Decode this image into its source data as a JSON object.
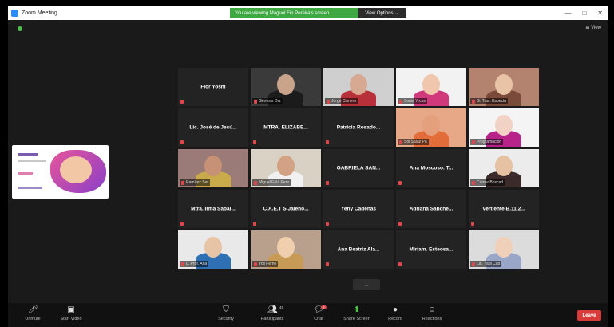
{
  "titlebar": {
    "app_title": "Zoom Meeting",
    "banner_message": "You are viewing Maguel Fin Pereira's screen",
    "banner_button": "View Options ⌄",
    "minimize": "—",
    "maximize": "□",
    "close": "✕"
  },
  "meeting": {
    "view_button": "⊞ View",
    "page_down": "⌄"
  },
  "tiles": [
    {
      "type": "name",
      "name": "Flor Yoshi"
    },
    {
      "type": "video",
      "label": "Genesis Orz",
      "skin": "#c9a38a",
      "shirt": "#1b1b1b",
      "bg": "#3a3a3a"
    },
    {
      "type": "video",
      "label": "Jorge Cisnero",
      "skin": "#d7a892",
      "shirt": "#b8313a",
      "bg": "#cfcfcf"
    },
    {
      "type": "video",
      "label": "Sonia Yrcos",
      "skin": "#f0c7ad",
      "shirt": "#d03a7d",
      "bg": "#f2f2f2"
    },
    {
      "type": "video",
      "label": "G. Tras. Especia",
      "skin": "#e9c3a6",
      "shirt": "#7a4a3a",
      "bg": "#b48370"
    },
    {
      "type": "name",
      "name": "Lic. José de Jesú..."
    },
    {
      "type": "name",
      "name": "MTRA. ELIZABE..."
    },
    {
      "type": "name",
      "name": "Patricia Rosado..."
    },
    {
      "type": "video",
      "label": "Sol Salaz Pa",
      "skin": "#e4a07c",
      "shirt": "#e36d3a",
      "bg": "#e6a887"
    },
    {
      "type": "video",
      "label": "Programación",
      "skin": "#f3d2c6",
      "shirt": "#b8238a",
      "bg": "#f4f4f4"
    },
    {
      "type": "video",
      "label": "Ramírez Ser",
      "skin": "#c79176",
      "shirt": "#c8aa4b",
      "bg": "#9a7b78"
    },
    {
      "type": "video",
      "label": "Miguel Eulá Pere",
      "skin": "#d3a184",
      "shirt": "#f0f0f0",
      "bg": "#d9d2c4",
      "active": true
    },
    {
      "type": "name",
      "name": "GABRIELA SAN..."
    },
    {
      "type": "name",
      "name": "Ana Moscoso. T..."
    },
    {
      "type": "video",
      "label": "Carme Boscad",
      "skin": "#e6c1a2",
      "shirt": "#3a2a2a",
      "bg": "#ececec"
    },
    {
      "type": "name",
      "name": "Mtra. Irma Sabal..."
    },
    {
      "type": "name",
      "name": "C.A.E.T S Jaleño..."
    },
    {
      "type": "name",
      "name": "Yeny Cadenas"
    },
    {
      "type": "name",
      "name": "Adriana Sánche..."
    },
    {
      "type": "name",
      "name": "Vertiente B.11.2..."
    },
    {
      "type": "video",
      "label": "L. Prof. Ana",
      "skin": "#e8c4a6",
      "shirt": "#2f6fb3",
      "bg": "#e9e9e9"
    },
    {
      "type": "video",
      "label": "Yoli Ferne",
      "skin": "#efcfae",
      "shirt": "#c79a55",
      "bg": "#b9a08c"
    },
    {
      "type": "name",
      "name": "Ana Beatriz Ala..."
    },
    {
      "type": "name",
      "name": "Miriam. Esteosa..."
    },
    {
      "type": "video",
      "label": "Lic. Yadi Cab",
      "skin": "#f0d0b8",
      "shirt": "#9aa6c7",
      "bg": "#dcdcdc"
    }
  ],
  "toolbar": {
    "unmute": "Unmute",
    "start_video": "Start Video",
    "security": "Security",
    "participants": "Participants",
    "participants_count": "49",
    "chat": "Chat",
    "chat_badge": "2",
    "share_screen": "Share Screen",
    "record": "Record",
    "reactions": "Reactions",
    "end": "Leave"
  },
  "colors": {
    "meeting_bg": "#1a1a1a",
    "banner_green": "#3ea843",
    "end_red": "#d93a3a",
    "active_speaker": "#c8d946"
  }
}
